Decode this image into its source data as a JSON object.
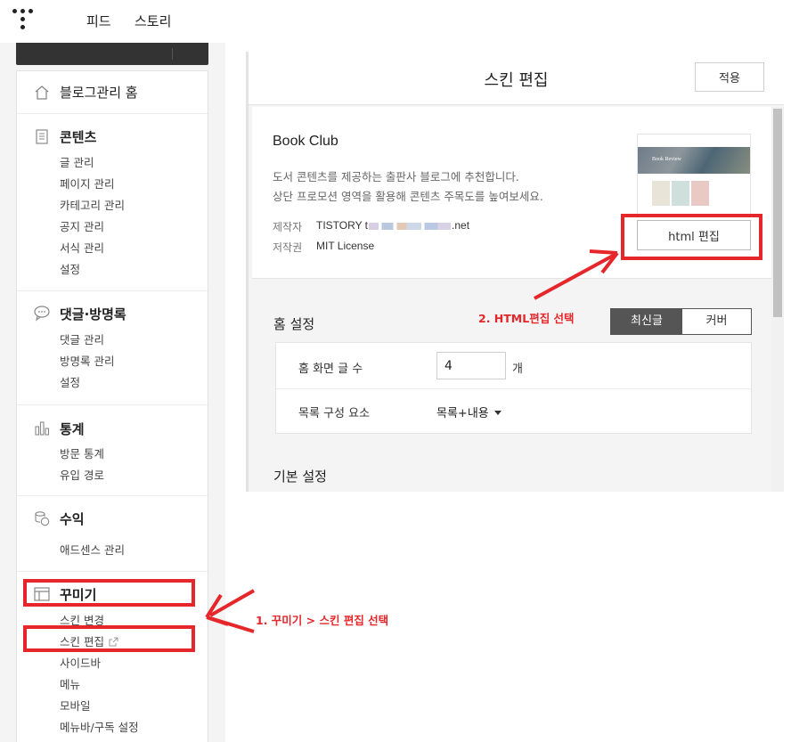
{
  "topbar": {
    "logo_icon": "tistory-dots-icon",
    "nav": [
      "피드",
      "스토리"
    ]
  },
  "sidebar": {
    "home": "블로그관리 홈",
    "sections": [
      {
        "title": "콘텐츠",
        "icon": "document-icon",
        "items": [
          "글 관리",
          "페이지 관리",
          "카테고리 관리",
          "공지 관리",
          "서식 관리",
          "설정"
        ]
      },
      {
        "title": "댓글·방명록",
        "icon": "speech-bubble-icon",
        "items": [
          "댓글 관리",
          "방명록 관리",
          "설정"
        ]
      },
      {
        "title": "통계",
        "icon": "bar-chart-icon",
        "items": [
          "방문 통계",
          "유입 경로"
        ]
      },
      {
        "title": "수익",
        "icon": "coins-icon",
        "items": [
          "애드센스 관리"
        ]
      },
      {
        "title": "꾸미기",
        "icon": "layout-icon",
        "items": [
          "스킨 변경",
          "스킨 편집",
          "사이드바",
          "메뉴",
          "모바일",
          "메뉴바/구독 설정"
        ]
      }
    ]
  },
  "editor": {
    "title": "스킨 편집",
    "apply_label": "적용",
    "skin_name": "Book Club",
    "skin_desc_1": "도서 콘텐츠를 제공하는 출판사 블로그에 추천합니다.",
    "skin_desc_2": "상단 프로모션 영역을 활용해 콘텐츠 주목도를 높여보세요.",
    "maker_label": "제작자",
    "maker_prefix": "TISTORY t",
    "maker_suffix": ".net",
    "license_label": "저작권",
    "license_value": "MIT License",
    "thumb_hero_text": "Book Review",
    "html_edit_label": "html 편집",
    "home_settings_title": "홈 설정",
    "tab_latest": "최신글",
    "tab_cover": "커버",
    "post_count_label": "홈 화면 글 수",
    "post_count_value": "4",
    "post_count_unit": "개",
    "list_element_label": "목록 구성 요소",
    "list_element_value": "목록+내용",
    "basic_settings_title": "기본 설정"
  },
  "annotations": {
    "step1": "1. 꾸미기 > 스킨 편집 선택",
    "step2": "2. HTML편집 선택",
    "color": "#e5262a"
  }
}
